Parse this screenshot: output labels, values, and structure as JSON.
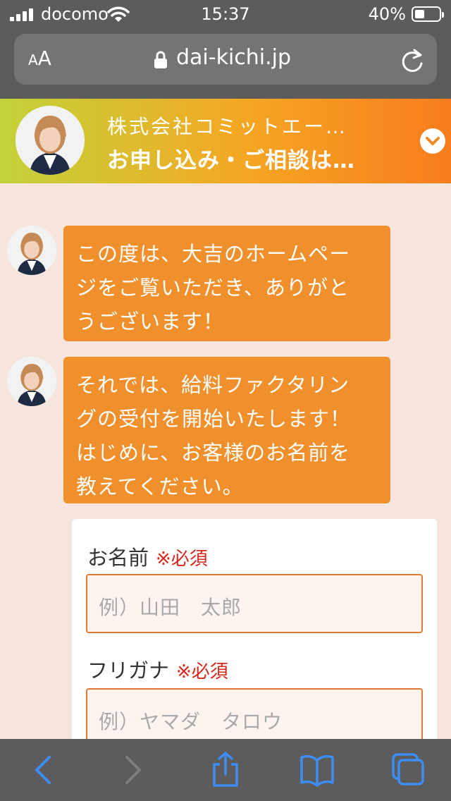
{
  "status": {
    "carrier": "docomo",
    "time": "15:37",
    "battery_pct": "40%",
    "battery_level": 0.4
  },
  "browser": {
    "aa_small": "A",
    "aa_large": "A",
    "url": "dai-kichi.jp"
  },
  "banner": {
    "company": "株式会社コミットエー…",
    "cta": "お申し込み・ご相談は…"
  },
  "messages": [
    {
      "lines": [
        "この度は、大吉のホームペー",
        "ジをご覧いただき、ありがと",
        "うございます！"
      ]
    },
    {
      "lines": [
        "それでは、給料ファクタリン",
        "グの受付を開始いたします！",
        "はじめに、お客様のお名前を",
        "教えてください。"
      ]
    }
  ],
  "form": {
    "name": {
      "label": "お名前",
      "required": "※必須",
      "placeholder": "例）山田　太郎"
    },
    "kana": {
      "label": "フリガナ",
      "required": "※必須",
      "placeholder": "例）ヤマダ　タロウ"
    }
  },
  "colors": {
    "accent": "#f0902d",
    "required": "#d9261c",
    "ios_blue": "#3d8df5",
    "background": "#f5e5dc"
  },
  "icons": {
    "back": "chevron-left-icon",
    "forward": "chevron-right-icon",
    "share": "share-icon",
    "bookmarks": "book-icon",
    "tabs": "tabs-icon"
  }
}
